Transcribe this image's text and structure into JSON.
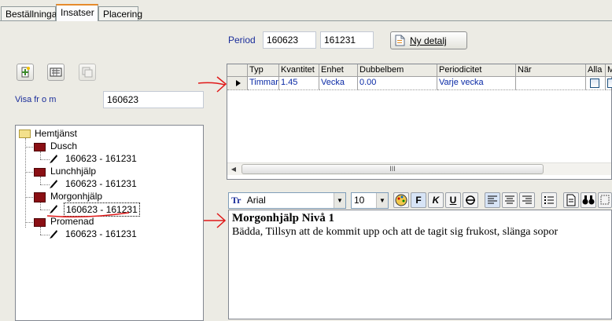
{
  "tabs": [
    {
      "label": "Beställningar",
      "active": false
    },
    {
      "label": "Insatser",
      "active": true
    },
    {
      "label": "Placering",
      "active": false
    }
  ],
  "period": {
    "label": "Period",
    "from": "160623",
    "to": "161231"
  },
  "new_detail_button": {
    "label": "Ny detalj"
  },
  "left_toolbar": {
    "icons": [
      "add-icon",
      "configure-icon",
      "disabled-copy-icon"
    ]
  },
  "show_from": {
    "label": "Visa fr o m",
    "value": "160623"
  },
  "tree": {
    "root": "Hemtjänst",
    "items": [
      {
        "label": "Dusch",
        "period": "160623 - 161231"
      },
      {
        "label": "Lunchhjälp",
        "period": "160623 - 161231"
      },
      {
        "label": "Morgonhjälp",
        "period": "160623 - 161231"
      },
      {
        "label": "Promenad",
        "period": "160623 - 161231"
      }
    ]
  },
  "grid": {
    "columns": [
      "Typ",
      "Kvantitet",
      "Enhet",
      "Dubbelbem",
      "Periodicitet",
      "När",
      "Alla",
      "M"
    ],
    "rows": [
      {
        "typ": "Timmar",
        "kvantitet": "1.45",
        "enhet": "Vecka",
        "dubbelbem": "0.00",
        "periodicitet": "Varje vecka",
        "nar": "",
        "alla": false,
        "m": false
      }
    ],
    "scroll_grip": "III"
  },
  "editor": {
    "font": "Arial",
    "size": "10",
    "format_buttons": [
      "F",
      "K",
      "U"
    ],
    "title": "Morgonhjälp Nivå 1",
    "body": "Bädda, Tillsyn att de kommit upp och att de tagit sig frukost, slänga sopor"
  },
  "colors": {
    "annotation": "#e01818",
    "accent": "#1a2d9a"
  }
}
